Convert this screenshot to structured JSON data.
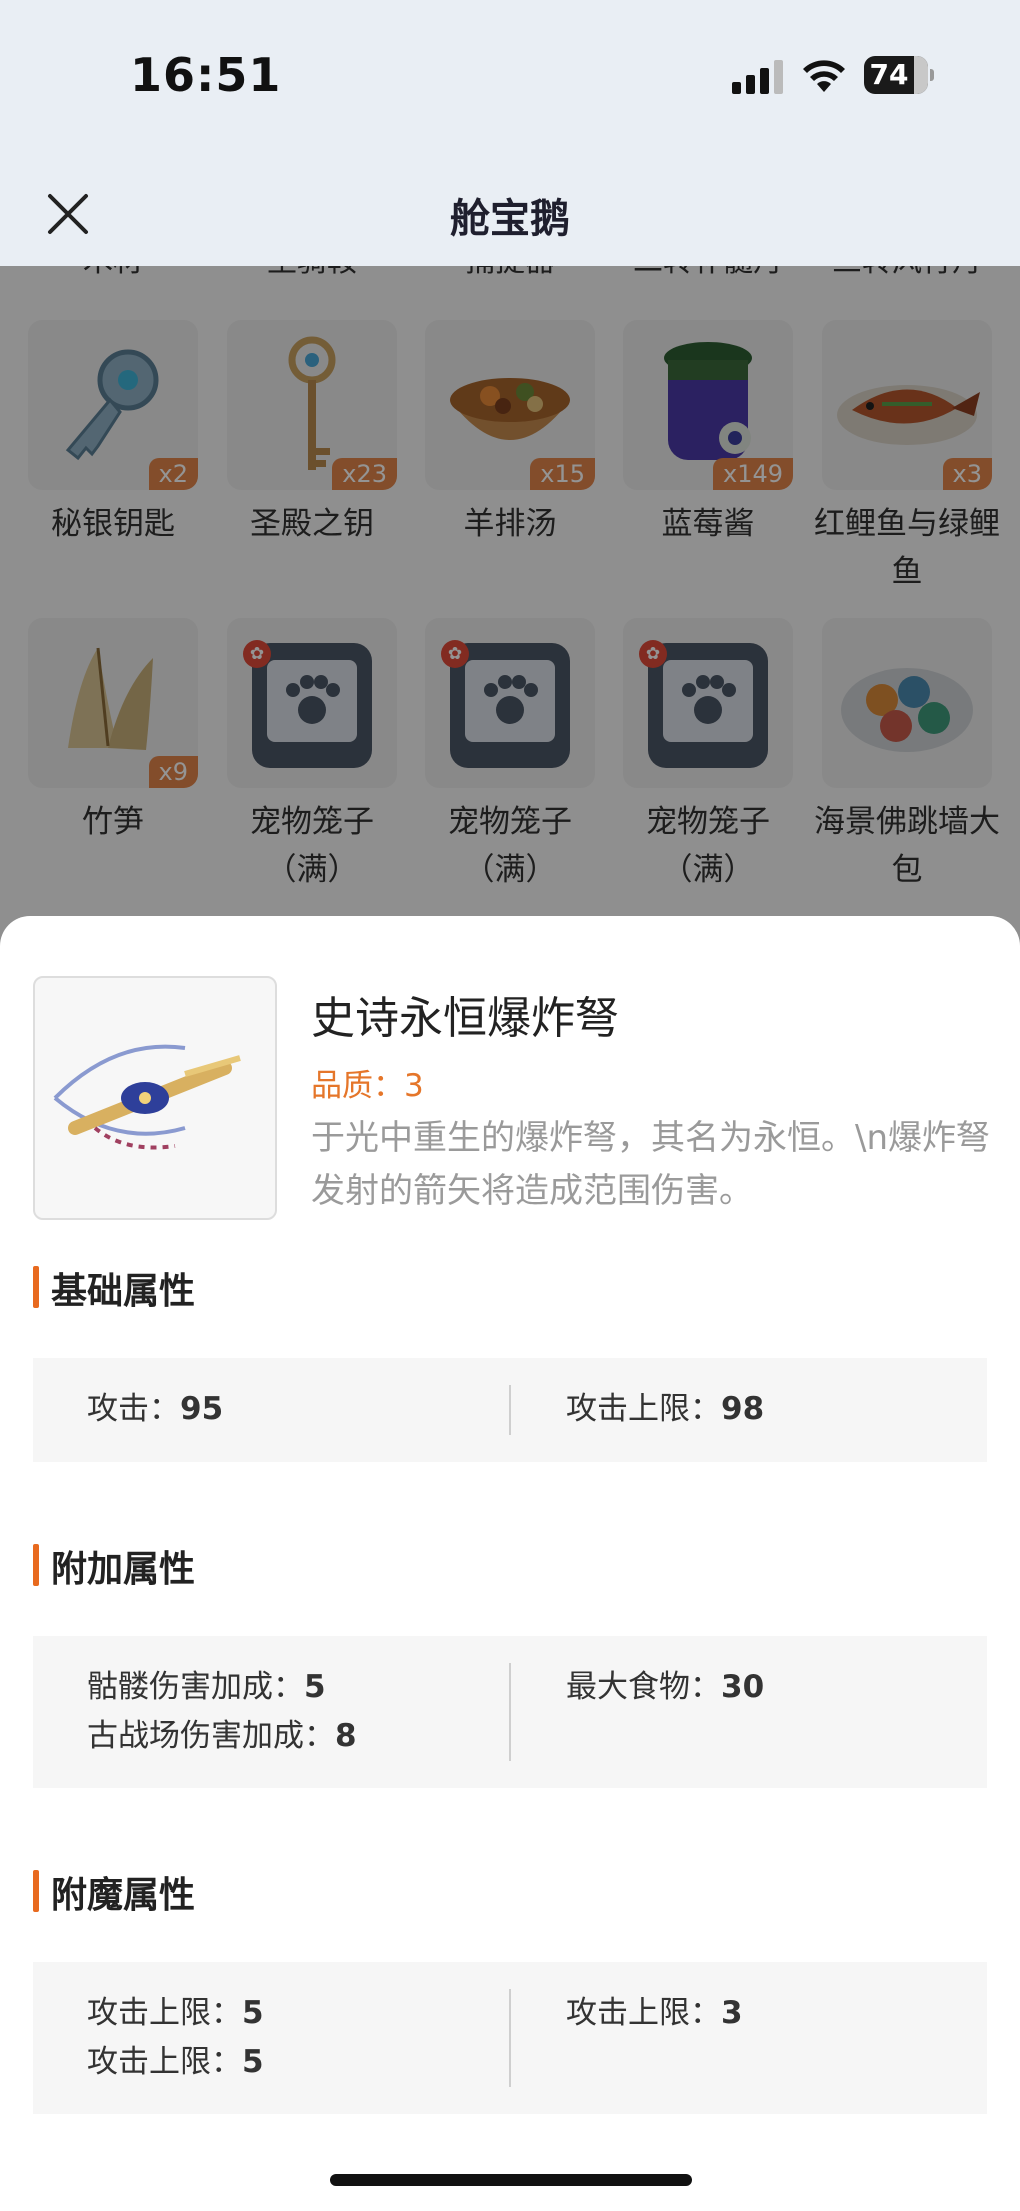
{
  "status_bar": {
    "time": "16:51",
    "battery": "74"
  },
  "header": {
    "title": "舱宝鹅"
  },
  "grid": {
    "cut_row": [
      "木材",
      "坐骑鞍",
      "捕捉器",
      "二转补髓丹",
      "三转风行丹"
    ],
    "row1": [
      {
        "label": "秘银钥匙",
        "qty": "x2",
        "icon": "key-icon"
      },
      {
        "label": "圣殿之钥",
        "qty": "x23",
        "icon": "scepter-key-icon"
      },
      {
        "label": "羊排汤",
        "qty": "x15",
        "icon": "soup-icon"
      },
      {
        "label": "蓝莓酱",
        "qty": "x149",
        "icon": "jam-jar-icon"
      },
      {
        "label": "红鲤鱼与绿鲤鱼",
        "qty": "x3",
        "icon": "fish-dish-icon"
      }
    ],
    "row2": [
      {
        "label": "竹笋",
        "qty": "x9",
        "icon": "bamboo-shoot-icon"
      },
      {
        "label": "宠物笼子（满）",
        "qty": "",
        "icon": "pet-cage-icon"
      },
      {
        "label": "宠物笼子（满）",
        "qty": "",
        "icon": "pet-cage-icon"
      },
      {
        "label": "宠物笼子（满）",
        "qty": "",
        "icon": "pet-cage-icon"
      },
      {
        "label": "海景佛跳墙大包",
        "qty": "",
        "icon": "buns-plate-icon"
      }
    ]
  },
  "item": {
    "name": "史诗永恒爆炸弩",
    "quality": "品质：3",
    "description": "于光中重生的爆炸弩，其名为永恒。\\n爆炸弩发射的箭矢将造成范围伤害。",
    "icon": "crossbow-icon"
  },
  "sections": {
    "basic": {
      "title": "基础属性",
      "left": [
        {
          "label": "攻击：",
          "value": "95"
        }
      ],
      "right": [
        {
          "label": "攻击上限：",
          "value": "98"
        }
      ]
    },
    "extra": {
      "title": "附加属性",
      "left": [
        {
          "label": "骷髅伤害加成：",
          "value": "5"
        },
        {
          "label": "古战场伤害加成：",
          "value": "8"
        }
      ],
      "right": [
        {
          "label": "最大食物：",
          "value": "30"
        }
      ]
    },
    "enchant": {
      "title": "附魔属性",
      "left": [
        {
          "label": "攻击上限：",
          "value": "5"
        },
        {
          "label": "攻击上限：",
          "value": "5"
        }
      ],
      "right": [
        {
          "label": "攻击上限：",
          "value": "3"
        }
      ]
    }
  },
  "colors": {
    "accent": "#e86a1f",
    "quality": "#e5762a",
    "qty_badge": "#e2864a"
  }
}
